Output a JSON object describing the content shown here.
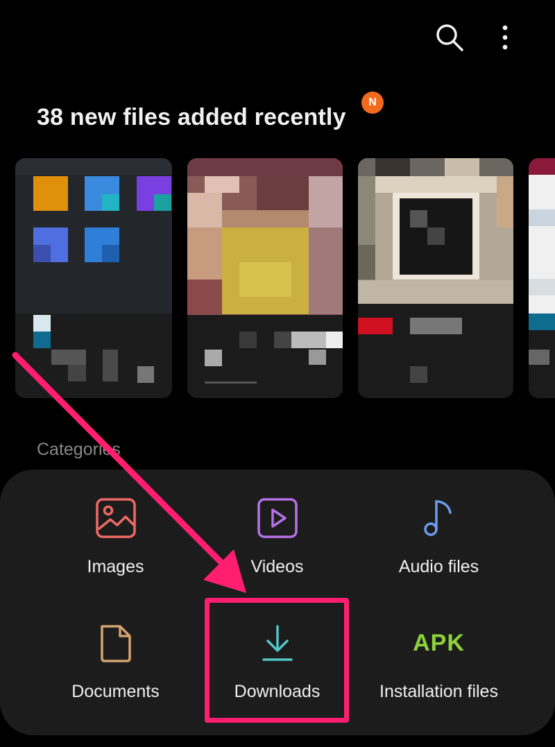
{
  "toolbar": {
    "search_icon": "search-icon",
    "more_icon": "more-vert-icon"
  },
  "recent": {
    "title": "38 new files added recently",
    "badge": "N"
  },
  "categories": {
    "label": "Categories",
    "items": [
      {
        "label": "Images",
        "icon": "image-icon",
        "color": "#ef6a66"
      },
      {
        "label": "Videos",
        "icon": "video-icon",
        "color": "#b571e8"
      },
      {
        "label": "Audio files",
        "icon": "music-note-icon",
        "color": "#6b9cf0"
      },
      {
        "label": "Documents",
        "icon": "document-icon",
        "color": "#d2a46e"
      },
      {
        "label": "Downloads",
        "icon": "download-icon",
        "color": "#55c6c6"
      },
      {
        "label": "Installation files",
        "icon": "apk-icon",
        "icon_text": "APK",
        "color": "#8dd33a"
      }
    ]
  },
  "annotation": {
    "color": "#ff1f6e"
  }
}
